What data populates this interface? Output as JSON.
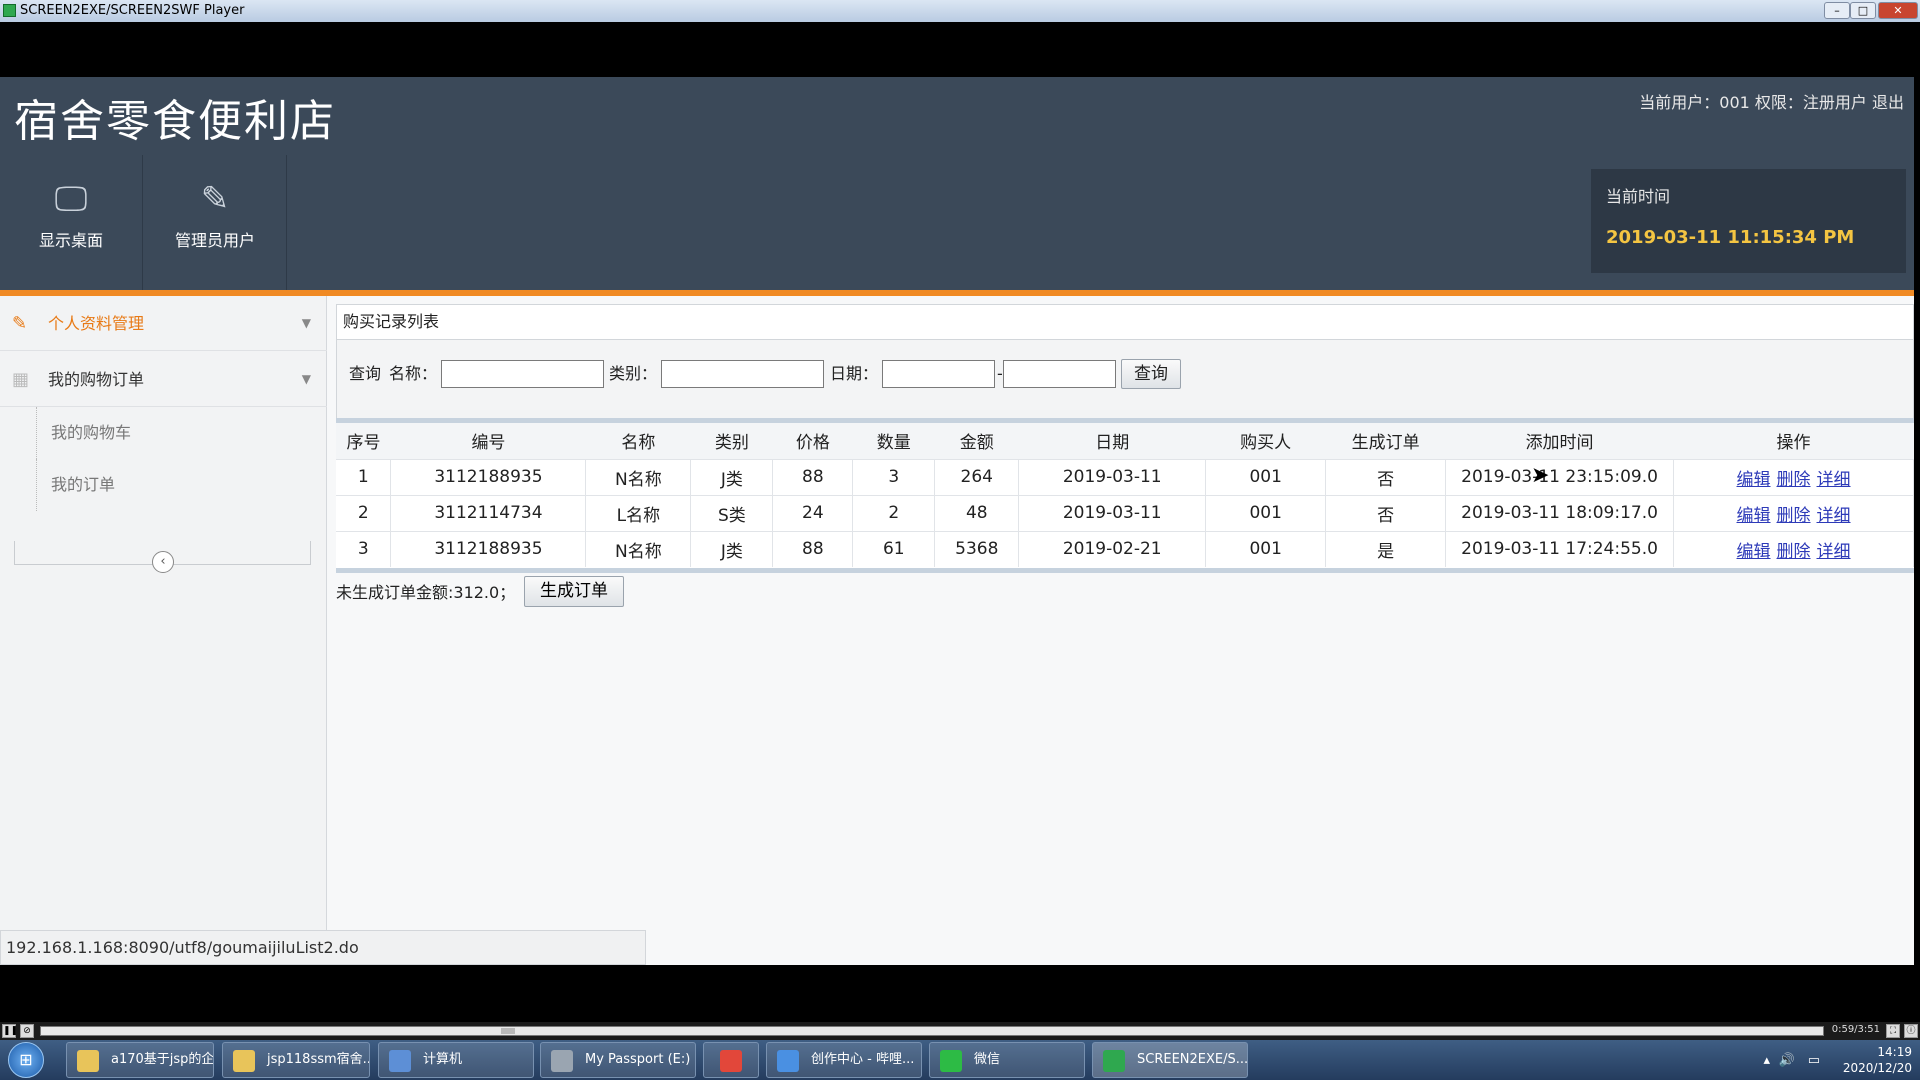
{
  "player": {
    "title": "SCREEN2EXE/SCREEN2SWF Player",
    "progress_time": "0:59/3:51",
    "progress": 0.26
  },
  "site": {
    "title": "宿舍零食便利店",
    "user_info": "当前用户：001  权限：注册用户  退出",
    "nav": [
      {
        "label": "显示桌面",
        "icon": "monitor-icon"
      },
      {
        "label": "管理员用户",
        "icon": "pencil-icon"
      }
    ],
    "time_box": {
      "label": "当前时间",
      "value": "2019-03-11 11:15:34 PM"
    },
    "accent_color": "#f08a24"
  },
  "sidebar": {
    "items": [
      {
        "label": "个人资料管理",
        "icon": "pencil-icon"
      },
      {
        "label": "我的购物订单",
        "icon": "grid-icon"
      }
    ],
    "sub_items": [
      {
        "label": "我的购物车"
      },
      {
        "label": "我的订单"
      }
    ],
    "collapse_symbol": "‹"
  },
  "main": {
    "panel_title": "购买记录列表",
    "query": {
      "prefix": "查询",
      "name_label": "名称：",
      "category_label": "类别：",
      "date_label": "日期：",
      "date_separator": "-",
      "name_value": "",
      "category_value": "",
      "date_from": "",
      "date_to": "",
      "button": "查询"
    },
    "table": {
      "columns": [
        "序号",
        "编号",
        "名称",
        "类别",
        "价格",
        "数量",
        "金额",
        "日期",
        "购买人",
        "生成订单",
        "添加时间",
        "操作"
      ],
      "rows": [
        [
          "1",
          "3112188935",
          "N名称",
          "J类",
          "88",
          "3",
          "264",
          "2019-03-11",
          "001",
          "否",
          "2019-03-11 23:15:09.0"
        ],
        [
          "2",
          "3112114734",
          "L名称",
          "S类",
          "24",
          "2",
          "48",
          "2019-03-11",
          "001",
          "否",
          "2019-03-11 18:09:17.0"
        ],
        [
          "3",
          "3112188935",
          "N名称",
          "J类",
          "88",
          "61",
          "5368",
          "2019-02-21",
          "001",
          "是",
          "2019-03-11 17:24:55.0"
        ]
      ],
      "actions": [
        "编辑",
        "删除",
        "详细"
      ]
    },
    "summary": "未生成订单金额:312.0；",
    "generate_button": "生成订单"
  },
  "status_bar": {
    "url": "192.168.1.168:8090/utf8/goumaijiluList2.do"
  },
  "taskbar": {
    "tasks": [
      {
        "label": "a170基于jsp的企...",
        "color": "#e8c45a"
      },
      {
        "label": "jsp118ssm宿舍...",
        "color": "#e8c45a"
      },
      {
        "label": "计算机",
        "color": "#5d8fd6"
      },
      {
        "label": "My Passport (E:)",
        "color": "#9aa5b1"
      },
      {
        "label": "",
        "color": "#e2473a"
      },
      {
        "label": "创作中心 - 哔哩...",
        "color": "#4a90e2"
      },
      {
        "label": "微信",
        "color": "#2dbb45"
      },
      {
        "label": "SCREEN2EXE/S...",
        "color": "#2fa84f"
      }
    ],
    "clock_time": "14:19",
    "clock_date": "2020/12/20"
  }
}
